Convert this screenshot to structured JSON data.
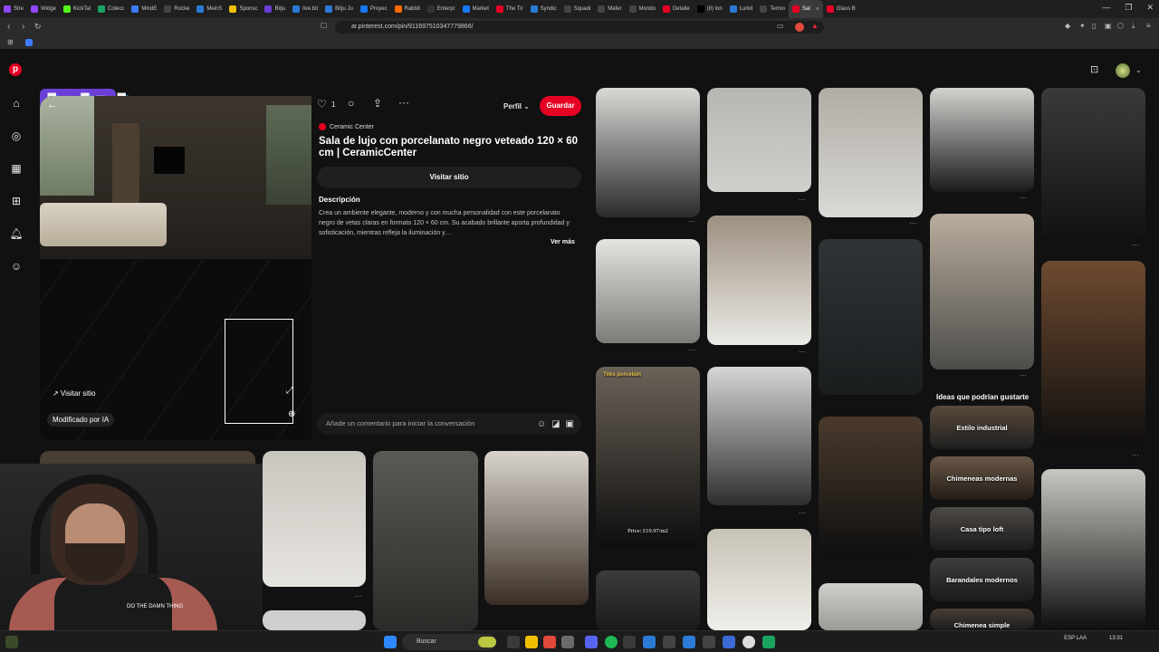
{
  "browser": {
    "tabs": [
      {
        "label": "Stre",
        "color": "#9147ff"
      },
      {
        "label": "Widge",
        "color": "#9147ff"
      },
      {
        "label": "KickTal",
        "color": "#53fc18"
      },
      {
        "label": "Colecc",
        "color": "#1aa260"
      },
      {
        "label": "MindE",
        "color": "#3b7cff"
      },
      {
        "label": "Rocke",
        "color": "#444"
      },
      {
        "label": "MeinS",
        "color": "#2b7bd6"
      },
      {
        "label": "Sponsc",
        "color": "#f0c000"
      },
      {
        "label": "Bitju",
        "color": "#6b3fd6"
      },
      {
        "label": "live.bit",
        "color": "#2b7bd6"
      },
      {
        "label": "Bitju Ju",
        "color": "#2b7bd6"
      },
      {
        "label": "Proyec",
        "color": "#1877f2"
      },
      {
        "label": "Rabbit",
        "color": "#ff6a00"
      },
      {
        "label": "Enterpr",
        "color": "#333"
      },
      {
        "label": "Market",
        "color": "#1877f2"
      },
      {
        "label": "The Tir",
        "color": "#e60023"
      },
      {
        "label": "Syndic",
        "color": "#2b7bd6"
      },
      {
        "label": "Squadi",
        "color": "#444"
      },
      {
        "label": "Mafer",
        "color": "#444"
      },
      {
        "label": "Mondo",
        "color": "#444"
      },
      {
        "label": "Detalle",
        "color": "#e60023"
      },
      {
        "label": "(8) lon",
        "color": "#000"
      },
      {
        "label": "Lurkit",
        "color": "#2b7bd6"
      },
      {
        "label": "Termo",
        "color": "#444"
      },
      {
        "label": "Sal",
        "color": "#e60023",
        "active": true
      },
      {
        "label": "Glass B",
        "color": "#e60023"
      }
    ],
    "url": "ar.pinterest.com/pin/911697510347779866/",
    "window_controls": {
      "minimize": "—",
      "maximize": "❐",
      "close": "✕"
    }
  },
  "overlay_logo": "bitju",
  "pin": {
    "likes": "1",
    "profile_label": "Perfil",
    "save_label": "Guardar",
    "board_name": "Ceramic Center",
    "title": "Sala de lujo con porcelanato negro veteado 120 × 60 cm | CeramicCenter",
    "visit_site_label": "Visitar sitio",
    "description_heading": "Descripción",
    "description": "Crea un ambiente elegante, moderno y con mucha personalidad con este porcelanato negro de vetas claras en formato 120 × 60 cm. Su acabado brillante aporta profundidad y sofisticación, mientras refleja la iluminación y…",
    "more_label": "Ver más",
    "image_visit_label": "↗ Visitar sitio",
    "ai_badge": "Modificado por IA",
    "comment_placeholder": "Añade un comentario para iniciar la conversación"
  },
  "grid": {
    "ideas_heading": "Ideas que podrían gustarte",
    "ideas": [
      "Estilo industrial",
      "Chimeneas modernas",
      "Casa tipo loft",
      "Barandales modernos",
      "Chimenea simple"
    ],
    "tile_texts": {
      "tiles_porcelain": "Tiles porcelain",
      "price": "Price: £19.97/m2"
    }
  },
  "taskbar": {
    "search_label": "Buscar",
    "lang": "ESP\nLAA",
    "clock": "13:31"
  },
  "webcam": {
    "caption": "DO THE DAMN THING"
  }
}
